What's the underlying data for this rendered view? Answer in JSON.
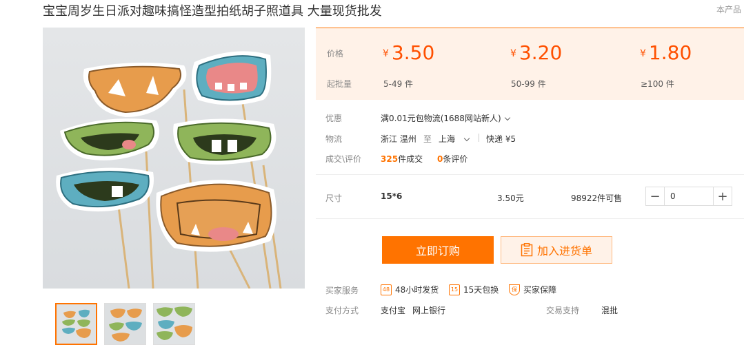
{
  "product": {
    "title": "宝宝周岁生日派对趣味搞怪造型拍纸胡子照道具 大量现货批发",
    "corner_text": "本产品"
  },
  "price_box": {
    "price_label": "价格",
    "moq_label": "起批量",
    "currency": "¥",
    "tiers": [
      {
        "price": "3.50",
        "moq": "5-49 件"
      },
      {
        "price": "3.20",
        "moq": "50-99 件"
      },
      {
        "price": "1.80",
        "moq": "≥100 件"
      }
    ]
  },
  "promotion": {
    "label": "优惠",
    "value": "满0.01元包物流(1688网站新人)"
  },
  "logistics": {
    "label": "物流",
    "from": "浙江 温州",
    "to_word": "至",
    "destination": "上海",
    "express": "快递 ¥5"
  },
  "deals": {
    "label": "成交\\评价",
    "sold_count": "325",
    "sold_text": "件成交",
    "review_count": "0",
    "review_text": "条评价"
  },
  "sku": {
    "label": "尺寸",
    "name": "15*6",
    "price": "3.50元",
    "stock": "98922件可售",
    "quantity": "0",
    "minus": "−",
    "plus": "+"
  },
  "actions": {
    "buy_now": "立即订购",
    "add_to_cart": "加入进货单"
  },
  "services": {
    "label": "买家服务",
    "items": [
      {
        "icon": "48",
        "text": "48小时发货"
      },
      {
        "icon": "15",
        "text": "15天包换"
      },
      {
        "icon": "保",
        "text": "买家保障"
      }
    ]
  },
  "payment": {
    "label": "支付方式",
    "methods": [
      "支付宝",
      "网上银行"
    ],
    "trade_label": "交易支持",
    "trade_value": "混批"
  },
  "colors": {
    "accent": "#ff7300",
    "price": "#ff5000",
    "price_bg": "#fff2e8"
  },
  "icons": [
    "cart-list-icon",
    "chevron-down-icon",
    "minus-icon",
    "plus-icon",
    "shipping-48h-icon",
    "exchange-15d-icon",
    "buyer-protection-icon"
  ]
}
